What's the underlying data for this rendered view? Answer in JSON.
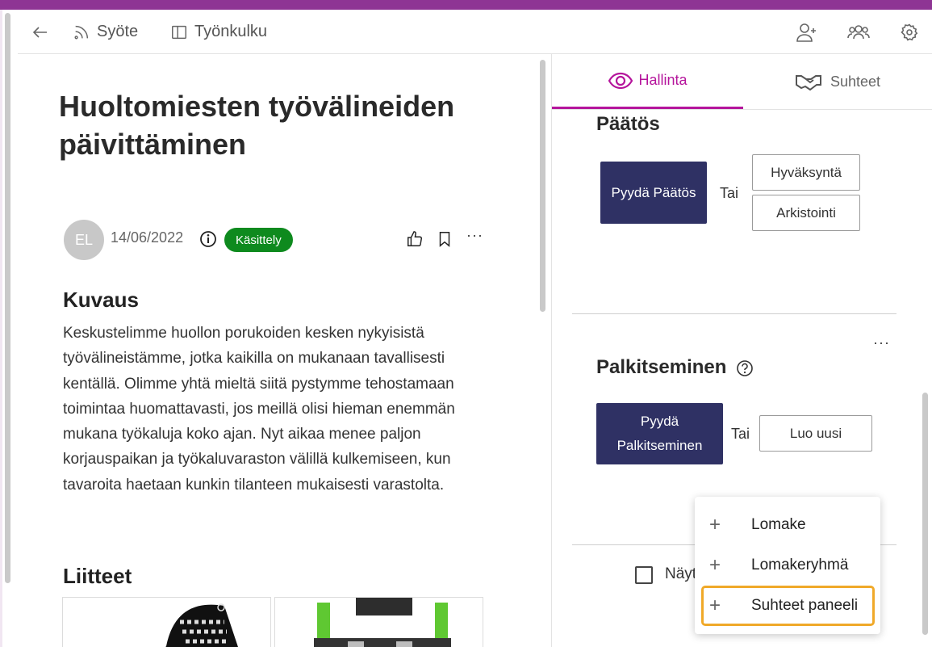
{
  "toolbar": {
    "feed_label": "Syöte",
    "workflow_label": "Työnkulku"
  },
  "post": {
    "title": "Huoltomiesten työvälineiden päivittäminen",
    "avatar_initials": "EL",
    "date": "14/06/2022",
    "status": "Käsittely",
    "more": "···",
    "description_heading": "Kuvaus",
    "description": "Keskustelimme huollon porukoiden kesken nykyisistä työvälineistämme, jotka kaikilla on mukanaan tavallisesti kentällä. Olimme yhtä mieltä siitä pystymme tehostamaan toimintaa huomattavasti, jos meillä olisi hieman enemmän mukana työkaluja koko ajan. Nyt aikaa menee paljon korjauspaikan ja työkaluvaraston välillä kulkemiseen, kun tavaroita haetaan kunkin tilanteen mukaisesti varastolta.",
    "attachments_heading": "Liitteet"
  },
  "tabs": {
    "hallinta": "Hallinta",
    "suhteet": "Suhteet"
  },
  "decision": {
    "title": "Päätös",
    "request_button": "Pyydä Päätös",
    "or": "Tai",
    "approve_button": "Hyväksyntä",
    "archive_button": "Arkistointi"
  },
  "reward": {
    "title": "Palkitseminen",
    "request_button": "Pyydä Palkitseminen",
    "or": "Tai",
    "create_button": "Luo uusi",
    "more": "···"
  },
  "show_checkbox": {
    "label": "Näyt"
  },
  "add_menu": {
    "items": [
      {
        "label": "Lomake"
      },
      {
        "label": "Lomakeryhmä"
      },
      {
        "label": "Suhteet paneeli"
      }
    ]
  },
  "colors": {
    "accent": "#8e3594",
    "tab_active": "#b5159c",
    "primary_button": "#2f3164",
    "status_badge": "#0e8a1e",
    "focus_ring": "#f0a929"
  }
}
